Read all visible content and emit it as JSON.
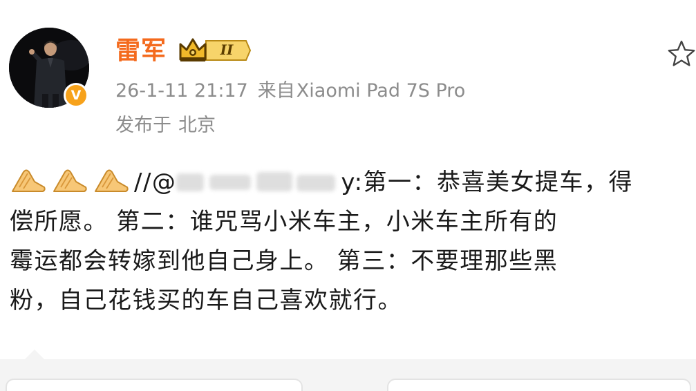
{
  "post": {
    "author": {
      "name": "雷军",
      "rank_label": "II",
      "verified_symbol": "V",
      "avatar_icon": "person-on-stage-avatar"
    },
    "meta": {
      "timestamp": "26-1-11 21:17",
      "source_prefix": "来自",
      "source_device": "Xiaomi Pad 7S Pro",
      "location_prefix": "发布于",
      "location": "北京"
    },
    "content": {
      "emoji_icon": "pray-hands-emoji",
      "emoji_count": 3,
      "mention_prefix": "//@",
      "mention_suffix": "y:",
      "line1_text": "第一：恭喜美女提车，得",
      "line2_text": "偿所愿。 第二：谁咒骂小米车主，小米车主所有的",
      "line3_text": "霉运都会转嫁到他自己身上。 第三：不要理那些黑",
      "line4_text": "粉，自己花钱买的车自己喜欢就行。"
    },
    "actions": {
      "favorite_icon": "star-outline-icon"
    }
  },
  "colors": {
    "username": "#f46a1d",
    "meta_text": "#8c8c8c",
    "body_text": "#1a1a1a",
    "verified_badge": "#f7a21b",
    "rank_badge": "#f5c242"
  }
}
